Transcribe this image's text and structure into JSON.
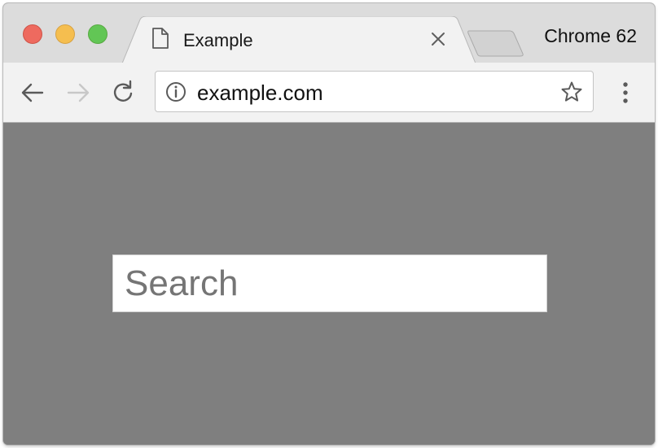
{
  "window": {
    "traffic_lights": [
      "close",
      "minimize",
      "zoom"
    ]
  },
  "tab": {
    "title": "Example",
    "favicon": "document-icon",
    "close_icon": "close-icon"
  },
  "tabstrip": {
    "new_tab_icon": "new-tab-icon",
    "browser_version": "Chrome 62"
  },
  "toolbar": {
    "back_icon": "arrow-left-icon",
    "forward_icon": "arrow-right-icon",
    "reload_icon": "reload-icon",
    "menu_icon": "vertical-dots-icon"
  },
  "omnibox": {
    "info_icon": "info-icon",
    "url": "example.com",
    "bookmark_icon": "star-icon"
  },
  "page": {
    "search": {
      "placeholder": "Search",
      "value": ""
    }
  },
  "colors": {
    "page_background": "#7f7f7f",
    "tabstrip_background": "#dcdcdc",
    "toolbar_background": "#f2f2f2",
    "traffic_red": "#ee6a5f",
    "traffic_yellow": "#f5be4f",
    "traffic_green": "#62c655"
  }
}
